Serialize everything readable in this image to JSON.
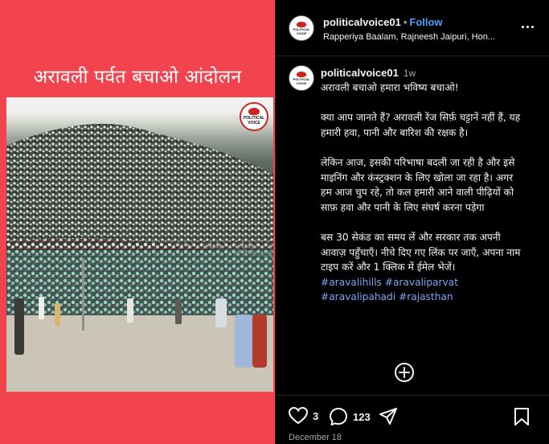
{
  "media": {
    "title": "अरावली पर्वत बचाओ आंदोलन",
    "logo_text": [
      "POLITICAL",
      "VOICE"
    ]
  },
  "header": {
    "username": "politicalvoice01",
    "separator": "•",
    "follow_label": "Follow",
    "audio": "Rapperiya Baalam, Rajneesh Jaipuri, Hon..."
  },
  "caption": {
    "username": "politicalvoice01",
    "time": "1w",
    "paragraphs": [
      "अरावली बचाओ हमारा भविष्य बचाओ!",
      "",
      "क्या आप जानते हैं? अरावली रेंज सिर्फ़ चट्टानें नहीं हैं, यह हमारी हवा, पानी और बारिश की रक्षक है।",
      "",
      "लेकिन आज, इसकी परिभाषा बदली जा रही है और इसे माइनिंग और कंस्ट्रक्शन के लिए खोला जा रहा है। अगर हम आज चुप रहे, तो कल हमारी आने वाली पीढ़ियों को साफ़ हवा और पानी के लिए संघर्ष करना पड़ेगा",
      "",
      "बस 30 सेकंड का समय लें और सरकार तक अपनी आवाज़ पहुँचाएँ। नीचे दिए गए लिंक पर जाएँ, अपना नाम टाइप करें और 1 क्लिक में ईमेल भेजें।"
    ],
    "hashtags": [
      "#aravalihills",
      "#aravaliparvat",
      "#aravalipahadi",
      "#rajasthan"
    ]
  },
  "actions": {
    "likes": "3",
    "comments": "123",
    "icons": [
      "heart-icon",
      "comment-icon",
      "share-icon",
      "bookmark-icon",
      "add-comment-icon",
      "more-icon"
    ]
  },
  "date": "December 18",
  "colors": {
    "media_bg": "#f1444e",
    "link": "#4a9df8",
    "hashtag": "#7ca6f0"
  }
}
